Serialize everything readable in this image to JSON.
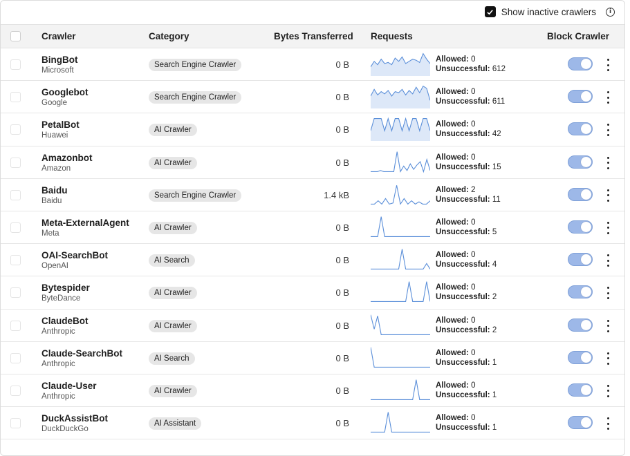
{
  "header": {
    "show_inactive_label": "Show inactive crawlers",
    "show_inactive_checked": true,
    "info_icon": "info-icon"
  },
  "columns": {
    "crawler": "Crawler",
    "category": "Category",
    "bytes": "Bytes Transferred",
    "requests": "Requests",
    "block": "Block Crawler"
  },
  "labels": {
    "allowed": "Allowed:",
    "unsuccessful": "Unsuccessful:"
  },
  "colors": {
    "sparkline": "#5b8fd9",
    "sparkline_fill": "#dde8f8",
    "toggle_track": "#9db8e8"
  },
  "rows": [
    {
      "name": "BingBot",
      "owner": "Microsoft",
      "category": "Search Engine Crawler",
      "bytes": "0 B",
      "allowed": "0",
      "unsuccessful": "612",
      "blocked": true,
      "spark": [
        0.35,
        0.6,
        0.45,
        0.7,
        0.5,
        0.55,
        0.45,
        0.75,
        0.6,
        0.8,
        0.5,
        0.6,
        0.7,
        0.65,
        0.55,
        0.95,
        0.7,
        0.5
      ],
      "fill": true
    },
    {
      "name": "Googlebot",
      "owner": "Google",
      "category": "Search Engine Crawler",
      "bytes": "0 B",
      "allowed": "0",
      "unsuccessful": "611",
      "blocked": true,
      "spark": [
        0.5,
        0.8,
        0.55,
        0.7,
        0.6,
        0.75,
        0.5,
        0.7,
        0.65,
        0.8,
        0.55,
        0.75,
        0.6,
        0.9,
        0.65,
        0.95,
        0.85,
        0.3
      ],
      "fill": true
    },
    {
      "name": "PetalBot",
      "owner": "Huawei",
      "category": "AI Crawler",
      "bytes": "0 B",
      "allowed": "0",
      "unsuccessful": "42",
      "blocked": true,
      "spark": [
        0.4,
        0.95,
        0.95,
        0.95,
        0.4,
        0.95,
        0.4,
        0.95,
        0.95,
        0.4,
        0.95,
        0.4,
        0.95,
        0.95,
        0.4,
        0.95,
        0.95,
        0.4
      ],
      "fill": true
    },
    {
      "name": "Amazonbot",
      "owner": "Amazon",
      "category": "AI Crawler",
      "bytes": "0 B",
      "allowed": "0",
      "unsuccessful": "15",
      "blocked": true,
      "spark": [
        0.05,
        0.05,
        0.05,
        0.1,
        0.05,
        0.05,
        0.05,
        0.05,
        0.95,
        0.05,
        0.3,
        0.1,
        0.4,
        0.15,
        0.35,
        0.5,
        0.05,
        0.6,
        0.1
      ],
      "fill": false
    },
    {
      "name": "Baidu",
      "owner": "Baidu",
      "category": "Search Engine Crawler",
      "bytes": "1.4 kB",
      "allowed": "2",
      "unsuccessful": "11",
      "blocked": true,
      "spark": [
        0.05,
        0.05,
        0.2,
        0.05,
        0.3,
        0.05,
        0.1,
        0.9,
        0.05,
        0.3,
        0.05,
        0.2,
        0.05,
        0.15,
        0.05,
        0.05,
        0.2
      ],
      "fill": false
    },
    {
      "name": "Meta-ExternalAgent",
      "owner": "Meta",
      "category": "AI Crawler",
      "bytes": "0 B",
      "allowed": "0",
      "unsuccessful": "5",
      "blocked": true,
      "spark": [
        0.05,
        0.05,
        0.05,
        0.95,
        0.05,
        0.05,
        0.05,
        0.05,
        0.05,
        0.05,
        0.05,
        0.05,
        0.05,
        0.05,
        0.05,
        0.05,
        0.05,
        0.05
      ],
      "fill": false
    },
    {
      "name": "OAI-SearchBot",
      "owner": "OpenAI",
      "category": "AI Search",
      "bytes": "0 B",
      "allowed": "0",
      "unsuccessful": "4",
      "blocked": true,
      "spark": [
        0.05,
        0.05,
        0.05,
        0.05,
        0.05,
        0.05,
        0.05,
        0.05,
        0.05,
        0.95,
        0.05,
        0.05,
        0.05,
        0.05,
        0.05,
        0.05,
        0.3,
        0.05
      ],
      "fill": false
    },
    {
      "name": "Bytespider",
      "owner": "ByteDance",
      "category": "AI Crawler",
      "bytes": "0 B",
      "allowed": "0",
      "unsuccessful": "2",
      "blocked": true,
      "spark": [
        0.05,
        0.05,
        0.05,
        0.05,
        0.05,
        0.05,
        0.05,
        0.05,
        0.05,
        0.05,
        0.05,
        0.95,
        0.05,
        0.05,
        0.05,
        0.05,
        0.95,
        0.05
      ],
      "fill": false
    },
    {
      "name": "ClaudeBot",
      "owner": "Anthropic",
      "category": "AI Crawler",
      "bytes": "0 B",
      "allowed": "0",
      "unsuccessful": "2",
      "blocked": true,
      "spark": [
        0.95,
        0.3,
        0.9,
        0.05,
        0.05,
        0.05,
        0.05,
        0.05,
        0.05,
        0.05,
        0.05,
        0.05,
        0.05,
        0.05,
        0.05,
        0.05,
        0.05,
        0.05
      ],
      "fill": false
    },
    {
      "name": "Claude-SearchBot",
      "owner": "Anthropic",
      "category": "AI Search",
      "bytes": "0 B",
      "allowed": "0",
      "unsuccessful": "1",
      "blocked": true,
      "spark": [
        0.95,
        0.05,
        0.05,
        0.05,
        0.05,
        0.05,
        0.05,
        0.05,
        0.05,
        0.05,
        0.05,
        0.05,
        0.05,
        0.05,
        0.05,
        0.05,
        0.05,
        0.05
      ],
      "fill": false
    },
    {
      "name": "Claude-User",
      "owner": "Anthropic",
      "category": "AI Crawler",
      "bytes": "0 B",
      "allowed": "0",
      "unsuccessful": "1",
      "blocked": true,
      "spark": [
        0.05,
        0.05,
        0.05,
        0.05,
        0.05,
        0.05,
        0.05,
        0.05,
        0.05,
        0.05,
        0.05,
        0.05,
        0.05,
        0.95,
        0.05,
        0.05,
        0.05,
        0.05
      ],
      "fill": false
    },
    {
      "name": "DuckAssistBot",
      "owner": "DuckDuckGo",
      "category": "AI Assistant",
      "bytes": "0 B",
      "allowed": "0",
      "unsuccessful": "1",
      "blocked": true,
      "spark": [
        0.05,
        0.05,
        0.05,
        0.05,
        0.05,
        0.95,
        0.05,
        0.05,
        0.05,
        0.05,
        0.05,
        0.05,
        0.05,
        0.05,
        0.05,
        0.05,
        0.05,
        0.05
      ],
      "fill": false
    }
  ]
}
